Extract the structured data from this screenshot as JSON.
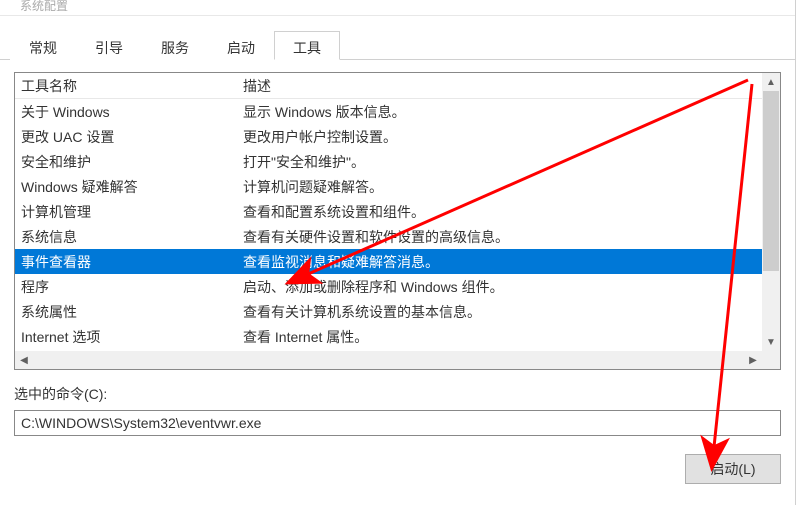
{
  "window": {
    "title": "系统配置"
  },
  "tabs": [
    {
      "label": "常规",
      "active": false
    },
    {
      "label": "引导",
      "active": false
    },
    {
      "label": "服务",
      "active": false
    },
    {
      "label": "启动",
      "active": false
    },
    {
      "label": "工具",
      "active": true
    }
  ],
  "table": {
    "headers": {
      "name": "工具名称",
      "desc": "描述"
    },
    "rows": [
      {
        "name": "关于 Windows",
        "desc": "显示 Windows 版本信息。",
        "selected": false
      },
      {
        "name": "更改 UAC 设置",
        "desc": "更改用户帐户控制设置。",
        "selected": false
      },
      {
        "name": "安全和维护",
        "desc": "打开\"安全和维护\"。",
        "selected": false
      },
      {
        "name": "Windows 疑难解答",
        "desc": "计算机问题疑难解答。",
        "selected": false
      },
      {
        "name": "计算机管理",
        "desc": "查看和配置系统设置和组件。",
        "selected": false
      },
      {
        "name": "系统信息",
        "desc": "查看有关硬件设置和软件设置的高级信息。",
        "selected": false
      },
      {
        "name": "事件查看器",
        "desc": "查看监视消息和疑难解答消息。",
        "selected": true
      },
      {
        "name": "程序",
        "desc": "启动、添加或删除程序和 Windows 组件。",
        "selected": false
      },
      {
        "name": "系统属性",
        "desc": "查看有关计算机系统设置的基本信息。",
        "selected": false
      },
      {
        "name": "Internet 选项",
        "desc": "查看 Internet 属性。",
        "selected": false
      }
    ]
  },
  "command": {
    "label": "选中的命令(C):",
    "value": "C:\\WINDOWS\\System32\\eventvwr.exe"
  },
  "buttons": {
    "launch": "启动(L)"
  },
  "annotation": {
    "arrow_color": "#ff0000"
  }
}
